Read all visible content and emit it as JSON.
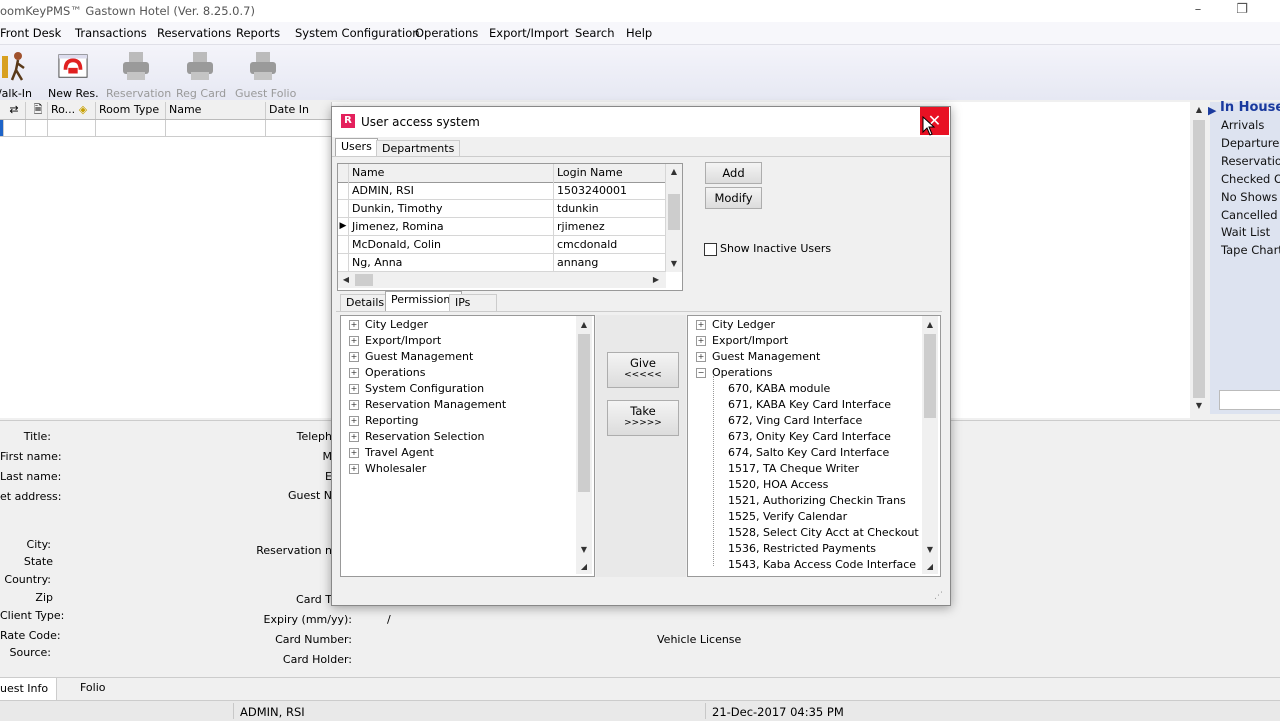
{
  "window": {
    "title": "oomKeyPMS™   Gastown Hotel (Ver. 8.25.0.7)"
  },
  "menu": [
    "Front Desk",
    "Transactions",
    "Reservations",
    "Reports",
    "System Configuration",
    "Operations",
    "Export/Import",
    "Search",
    "Help"
  ],
  "toolbar": [
    {
      "label": "/alk-In",
      "icon": "walk-in-icon",
      "enabled": true
    },
    {
      "label": "New Res.",
      "icon": "phone-icon",
      "enabled": true
    },
    {
      "label": "Reservation",
      "icon": "printer-icon",
      "enabled": false
    },
    {
      "label": "Reg Card",
      "icon": "printer-icon",
      "enabled": false
    },
    {
      "label": "Guest Folio",
      "icon": "printer-icon",
      "enabled": false
    }
  ],
  "room_grid": {
    "columns": [
      "Ro...",
      "Room Type",
      "Name",
      "Date In"
    ]
  },
  "in_house": {
    "title": "In House",
    "items": [
      "Arrivals",
      "Departures",
      "Reservations",
      "Checked Ou",
      "No Shows",
      "Cancelled",
      "Wait List",
      "Tape Chart"
    ]
  },
  "guest_info": {
    "labels_left": [
      "Title:",
      "First name:",
      "Last name:",
      "et address:",
      "City:",
      "State",
      "Country:",
      "Zip",
      "Client Type:",
      "Rate Code:",
      "Source:"
    ],
    "labels_mid": [
      "Teleph",
      "M",
      "E",
      "Guest N",
      "Reservation n",
      "Card T",
      "Expiry (mm/yy):",
      "Card Number:",
      "Card Holder:"
    ],
    "expiry_value": "/",
    "vehicle_label": "Vehicle License"
  },
  "bottom_tabs": [
    "uest Info",
    "Folio"
  ],
  "status": {
    "user": "ADMIN, RSI",
    "datetime": "21-Dec-2017 04:35 PM"
  },
  "dialog": {
    "title": "User access system",
    "top_tabs": [
      "Users",
      "Departments"
    ],
    "users_columns": [
      "Name",
      "Login Name"
    ],
    "users": [
      {
        "name": "ADMIN, RSI",
        "login": "1503240001"
      },
      {
        "name": "Dunkin, Timothy",
        "login": "tdunkin"
      },
      {
        "name": "Jimenez, Romina",
        "login": "rjimenez",
        "current": true
      },
      {
        "name": "McDonald, Colin",
        "login": "cmcdonald"
      },
      {
        "name": "Ng, Anna",
        "login": "annang"
      }
    ],
    "add_label": "Add",
    "modify_label": "Modify",
    "show_inactive_label": "Show Inactive Users",
    "sub_tabs": [
      "Details",
      "Permissions",
      "IPs"
    ],
    "available": [
      "City Ledger",
      "Export/Import",
      "Guest Management",
      "Operations",
      "System Configuration",
      "Reservation Management",
      "Reporting",
      "Reservation Selection",
      "Travel Agent",
      "Wholesaler"
    ],
    "give_label": "Give",
    "give_arrows": "<<<<<",
    "take_label": "Take",
    "take_arrows": ">>>>>",
    "granted_groups": [
      "City Ledger",
      "Export/Import",
      "Guest Management",
      "Operations"
    ],
    "granted_operations": [
      "670, KABA module",
      "671, KABA Key Card Interface",
      "672, Ving Card Interface",
      "673, Onity Key Card Interface",
      "674, Salto Key Card Interface",
      "1517, TA Cheque Writer",
      "1520, HOA Access",
      "1521, Authorizing Checkin Trans",
      "1525, Verify Calendar",
      "1528, Select City Acct at Checkout",
      "1536, Restricted Payments",
      "1543, Kaba Access Code Interface"
    ]
  }
}
